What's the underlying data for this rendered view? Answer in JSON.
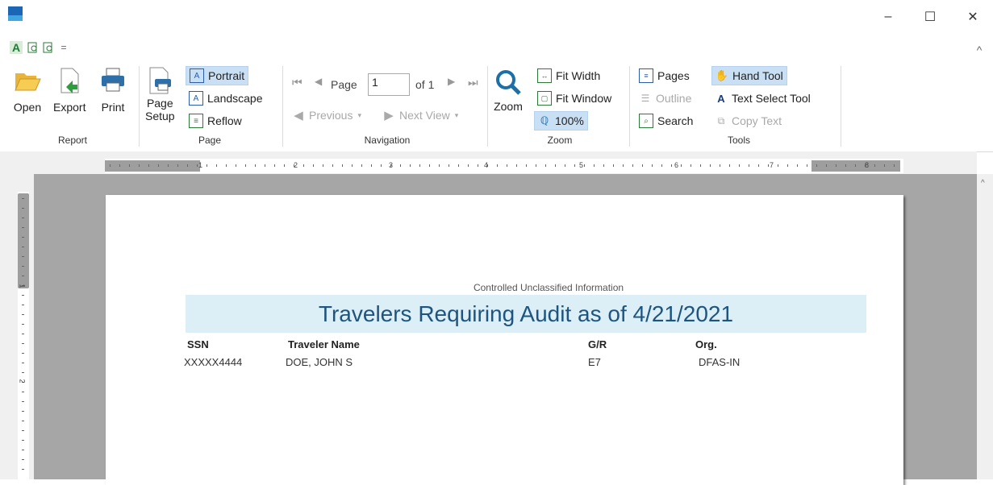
{
  "window": {
    "title": "",
    "controls": {
      "minimize": "‒",
      "maximize": "☐",
      "close": "✕"
    }
  },
  "quick_access": {
    "overflow": "="
  },
  "ribbon": {
    "collapse": "^",
    "report": {
      "label": "Report",
      "open": "Open",
      "export": "Export",
      "print": "Print"
    },
    "page": {
      "label": "Page",
      "page_setup_line1": "Page",
      "page_setup_line2": "Setup",
      "portrait": "Portrait",
      "landscape": "Landscape",
      "reflow": "Reflow"
    },
    "navigation": {
      "label": "Navigation",
      "page_label": "Page",
      "page_value": "1",
      "of_label": "of 1",
      "previous": "Previous",
      "next_view": "Next View"
    },
    "zoom": {
      "label": "Zoom",
      "zoom": "Zoom",
      "fit_width": "Fit Width",
      "fit_window": "Fit Window",
      "zoom_100": "100%"
    },
    "tools": {
      "label": "Tools",
      "pages": "Pages",
      "outline": "Outline",
      "search": "Search",
      "hand_tool": "Hand Tool",
      "text_select": "Text Select Tool",
      "copy_text": "Copy Text"
    }
  },
  "ruler": {
    "h_labels": [
      "1",
      "2",
      "3",
      "4",
      "5",
      "6",
      "7",
      "8"
    ],
    "v_labels": [
      "1",
      "2"
    ]
  },
  "report": {
    "cui": "Controlled Unclassified Information",
    "title": "Travelers Requiring Audit as of 4/21/2021",
    "columns": [
      "SSN",
      "Traveler Name",
      "G/R",
      "Org."
    ],
    "rows": [
      [
        "XXXXX4444",
        "DOE, JOHN S",
        "E7",
        "DFAS-IN"
      ]
    ]
  },
  "colors": {
    "banner_bg": "#dceef6",
    "banner_text": "#1d5580",
    "selected": "#c9dff4"
  }
}
